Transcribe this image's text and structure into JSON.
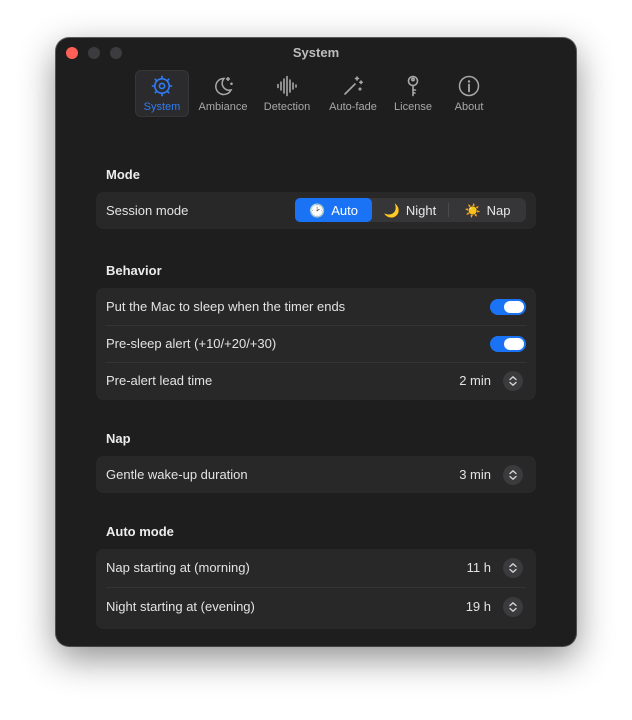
{
  "window": {
    "title": "System",
    "traffic_lights": {
      "close_color": "#fe5f57",
      "inactive_color": "#3c3c3e"
    }
  },
  "toolbar": {
    "accent_color": "#2f7cf6",
    "tabs": [
      {
        "label": "System",
        "icon": "gear-icon",
        "active": true
      },
      {
        "label": "Ambiance",
        "icon": "moon-stars-icon",
        "active": false
      },
      {
        "label": "Detection",
        "icon": "waveform-icon",
        "active": false
      },
      {
        "label": "Auto-fade",
        "icon": "magic-wand-icon",
        "active": false
      },
      {
        "label": "License",
        "icon": "key-icon",
        "active": false
      },
      {
        "label": "About",
        "icon": "info-icon",
        "active": false
      }
    ]
  },
  "sections": {
    "mode": {
      "title": "Mode",
      "session_mode": {
        "label": "Session mode",
        "options": [
          {
            "label": "Auto",
            "glyph": "🕑",
            "icon": "clock-icon",
            "selected": true
          },
          {
            "label": "Night",
            "glyph": "🌙",
            "icon": "moon-icon",
            "selected": false
          },
          {
            "label": "Nap",
            "glyph": "☀️",
            "icon": "sun-icon",
            "selected": false
          }
        ]
      }
    },
    "behavior": {
      "title": "Behavior",
      "sleep_at_end": {
        "label": "Put the Mac to sleep when the timer ends",
        "enabled": true
      },
      "pre_sleep_alert": {
        "label": "Pre-sleep alert (+10/+20/+30)",
        "enabled": true
      },
      "pre_alert_lead_time": {
        "label": "Pre-alert lead time",
        "value": "2 min"
      }
    },
    "nap": {
      "title": "Nap",
      "gentle_wakeup": {
        "label": "Gentle wake-up duration",
        "value": "3 min"
      }
    },
    "auto_mode": {
      "title": "Auto mode",
      "nap_start": {
        "label": "Nap starting at (morning)",
        "value": "11 h"
      },
      "night_start": {
        "label": "Night starting at (evening)",
        "value": "19 h"
      }
    }
  },
  "colors": {
    "window_bg": "#1e1e1e",
    "card_bg": "#282829",
    "toggle_on": "#1a73f5",
    "segment_selected": "#1a73f5"
  }
}
